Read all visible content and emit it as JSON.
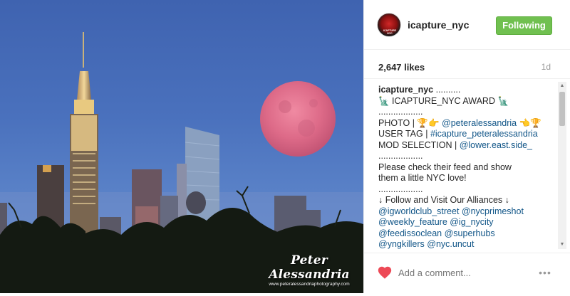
{
  "post": {
    "watermark_signature": "Peter Alessandria",
    "watermark_site": "www.peteralessandriaphotography.com"
  },
  "header": {
    "username": "icapture_nyc",
    "follow_label": "Following",
    "avatar_text": "ICAPTURE NYC"
  },
  "stats": {
    "likes": "2,647 likes",
    "age": "1d"
  },
  "caption": {
    "username": "icapture_nyc",
    "lines": [
      " ..........",
      "🗽 ICAPTURE_NYC AWARD 🗽",
      "..................",
      "PHOTO | 🏆👉 ",
      " 👈🏆",
      "USER TAG | ",
      "MOD SELECTION | ",
      "..................",
      "Please check their feed and show",
      "them a little NYC love!",
      "..................",
      "↓ Follow and Visit Our Alliances ↓"
    ],
    "photo_tag": "@peteralessandria",
    "user_tag": "#icapture_peteralessandria",
    "mod_tag": "@lower.east.side_",
    "alliances": [
      "@igworldclub_street @nycprimeshot",
      "@weekly_feature @ig_nycity",
      "@feedissoclean @superhubs",
      "@yngkillers @nyc.uncut"
    ]
  },
  "footer": {
    "comment_placeholder": "Add a comment...",
    "more_label": "•••"
  },
  "colors": {
    "follow_green": "#70c050",
    "heart_red": "#ed4956",
    "link_blue": "#125688",
    "moon_pink": "#e0708c"
  },
  "icons": {
    "like": "heart-icon",
    "more": "ellipsis-icon"
  }
}
